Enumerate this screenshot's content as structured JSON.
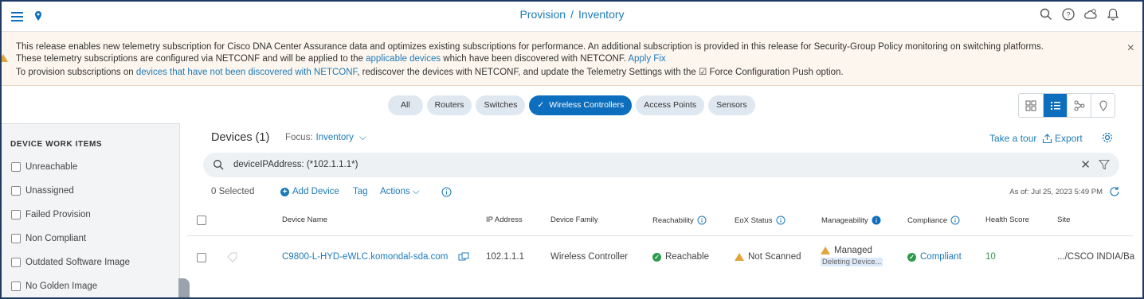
{
  "header": {
    "breadcrumb_parent": "Provision",
    "breadcrumb_sep": "/",
    "breadcrumb_current": "Inventory",
    "icons": [
      "menu-icon",
      "location-pin-icon",
      "search-icon",
      "help-icon",
      "cloud-icon",
      "bell-icon"
    ]
  },
  "banner": {
    "line1": "This release enables new telemetry subscription for Cisco DNA Center Assurance data and optimizes existing subscriptions for performance. An additional subscription is provided in this release for Security-Group Policy monitoring on switching platforms.",
    "line2_a": "These telemetry subscriptions are configured via NETCONF and will be applied to the ",
    "line2_link": "applicable devices",
    "line2_b": " which have been discovered with NETCONF. ",
    "line2_link2": "Apply Fix",
    "line3_a": "To provision subscriptions on ",
    "line3_link": "devices that have not been discovered with NETCONF",
    "line3_b": ", rediscover the devices with NETCONF, and update the Telemetry Settings with the ☑ Force Configuration Push option.",
    "close": "×"
  },
  "filters": {
    "pills": [
      "All",
      "Routers",
      "Switches",
      "Wireless Controllers",
      "Access Points",
      "Sensors"
    ],
    "active": "Wireless Controllers"
  },
  "left_panel": {
    "title": "DEVICE WORK ITEMS",
    "items": [
      "Unreachable",
      "Unassigned",
      "Failed Provision",
      "Non Compliant",
      "Outdated Software Image",
      "No Golden Image"
    ]
  },
  "devices": {
    "title": "Devices (1)",
    "focus_label": "Focus:",
    "focus_value": "Inventory",
    "take_tour": "Take a tour",
    "export": "Export",
    "search_value": "deviceIPAddress: (*102.1.1.1*)",
    "selected": "0 Selected",
    "add_device": "Add Device",
    "tag": "Tag",
    "actions": "Actions",
    "as_of": "As of: Jul 25, 2023 5:49 PM",
    "columns": [
      "Device Name",
      "IP Address",
      "Device Family",
      "Reachability",
      "EoX Status",
      "Manageability",
      "Compliance",
      "Health Score",
      "Site"
    ],
    "rows": [
      {
        "device_name": "C9800-L-HYD-eWLC.komondal-sda.com",
        "ip": "102.1.1.1",
        "family": "Wireless Controller",
        "reachability": "Reachable",
        "eox": "Not Scanned",
        "manageability": "Managed",
        "manageability_sub": "Deleting Device...",
        "compliance": "Compliant",
        "health": "10",
        "site": ".../CSCO INDIA/Ba"
      }
    ]
  },
  "colors": {
    "accent": "#0d6ebd",
    "success": "#2c9a4b",
    "warning": "#e2a43b"
  }
}
